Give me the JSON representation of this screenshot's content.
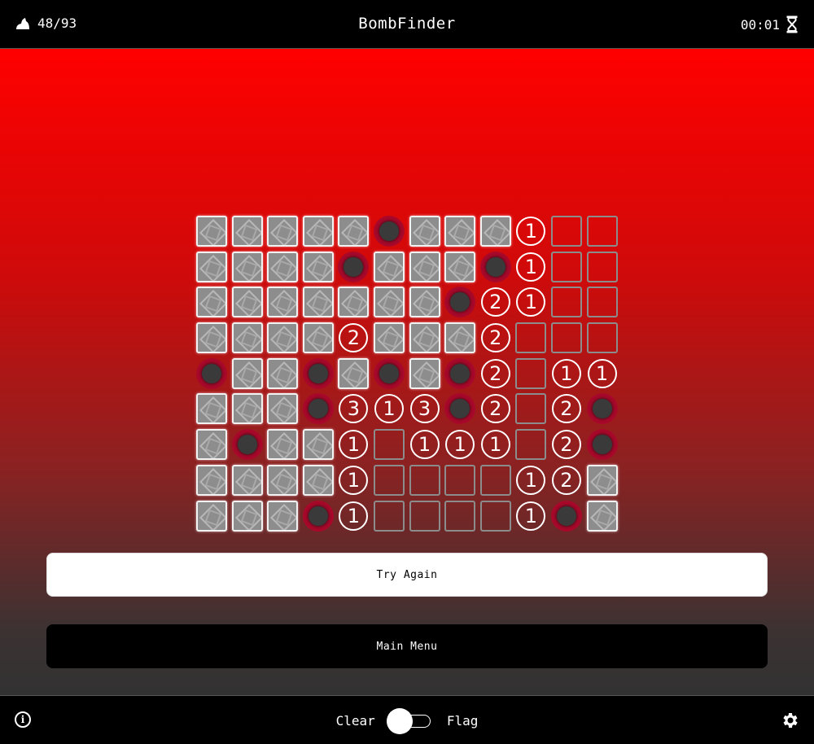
{
  "header": {
    "flag_icon": "flag-icon",
    "flags_count": "48/93",
    "title": "BombFinder",
    "timer": "00:01",
    "timer_icon": "hourglass-icon"
  },
  "board": {
    "rows": 9,
    "cols": 12,
    "legend": {
      "H": "hidden",
      "E": "empty",
      "M": "mine",
      "1": "number",
      "2": "number",
      "3": "number"
    },
    "grid": [
      [
        "H",
        "H",
        "H",
        "H",
        "H",
        "M",
        "H",
        "H",
        "H",
        "1",
        "E",
        "E"
      ],
      [
        "H",
        "H",
        "H",
        "H",
        "M",
        "H",
        "H",
        "H",
        "M",
        "1",
        "E",
        "E"
      ],
      [
        "H",
        "H",
        "H",
        "H",
        "H",
        "H",
        "H",
        "M",
        "2",
        "1",
        "E",
        "E"
      ],
      [
        "H",
        "H",
        "H",
        "H",
        "2",
        "H",
        "H",
        "H",
        "2",
        "E",
        "E",
        "E"
      ],
      [
        "M",
        "H",
        "H",
        "M",
        "H",
        "M",
        "H",
        "M",
        "2",
        "E",
        "1",
        "1"
      ],
      [
        "H",
        "H",
        "H",
        "M",
        "3",
        "1",
        "3",
        "M",
        "2",
        "E",
        "2",
        "M"
      ],
      [
        "H",
        "M",
        "H",
        "H",
        "1",
        "E",
        "1",
        "1",
        "1",
        "E",
        "2",
        "M"
      ],
      [
        "H",
        "H",
        "H",
        "H",
        "1",
        "E",
        "E",
        "E",
        "E",
        "1",
        "2",
        "H"
      ],
      [
        "H",
        "H",
        "H",
        "M",
        "1",
        "E",
        "E",
        "E",
        "E",
        "1",
        "M",
        "H"
      ]
    ]
  },
  "actions": {
    "try_again": "Try Again",
    "main_menu": "Main Menu"
  },
  "footer": {
    "info_icon": "info-icon",
    "mode_left": "Clear",
    "mode_right": "Flag",
    "mode_state": "Clear",
    "settings_icon": "gear-icon"
  },
  "colors": {
    "gradient_top": "#ff0000",
    "gradient_bottom": "#323232",
    "mine_ring": "#a8082a"
  }
}
